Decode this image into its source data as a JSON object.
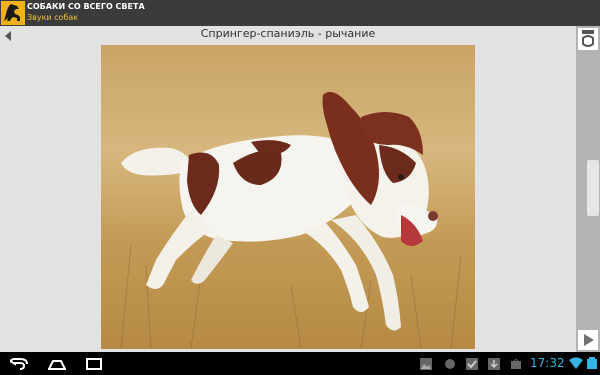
{
  "app": {
    "title": "СОБАКИ СО ВСЕГО СВЕТА",
    "subtitle": "Звуки собак"
  },
  "sound": {
    "title": "Спрингер-спаниэль - рычание"
  },
  "photo": {
    "subject": "dog-photo"
  },
  "status_bar": {
    "time": "17:32"
  },
  "colors": {
    "accent": "#33b5e5",
    "subtitle": "#f3c233",
    "logo_bg": "#f1b11b",
    "title_bar": "#3b3b3b"
  }
}
